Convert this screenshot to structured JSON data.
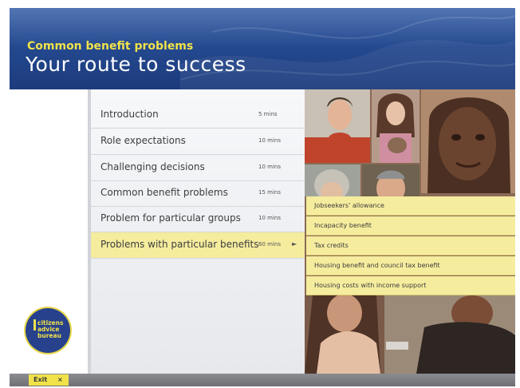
{
  "header": {
    "subtitle": "Common benefit problems",
    "title": "Your route to success"
  },
  "menu": {
    "items": [
      {
        "label": "Introduction",
        "time": "5 mins"
      },
      {
        "label": "Role expectations",
        "time": "10 mins"
      },
      {
        "label": "Challenging decisions",
        "time": "10 mins"
      },
      {
        "label": "Common benefit problems",
        "time": "15 mins"
      },
      {
        "label": "Problem for particular groups",
        "time": "10 mins"
      },
      {
        "label": "Problems with particular benefits",
        "time": "60 mins",
        "active": true,
        "arrow": "►"
      }
    ]
  },
  "submenu": {
    "items": [
      {
        "label": "Jobseekers' allowance"
      },
      {
        "label": "Incapacity benefit"
      },
      {
        "label": "Tax credits"
      },
      {
        "label": "Housing benefit and council tax benefit"
      },
      {
        "label": "Housing costs with income support"
      }
    ]
  },
  "logo": {
    "line1": "citizens",
    "line2": "advice",
    "line3": "bureau"
  },
  "footer": {
    "exit_label": "Exit",
    "exit_icon": "×"
  },
  "colors": {
    "header_blue": "#24488e",
    "accent_yellow": "#f1e24a",
    "highlight_yellow": "#f5ec9e"
  }
}
